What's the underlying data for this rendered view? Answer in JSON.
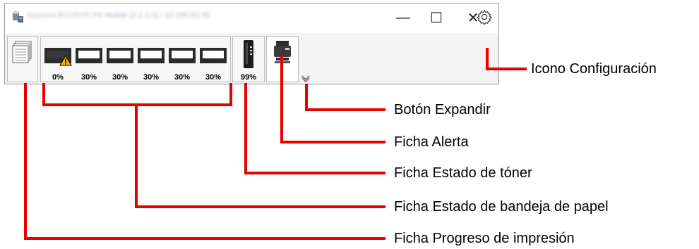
{
  "window": {
    "title": "Kyocera ECOSYS P4 Mobile (2.1.1.0) / 10.180.62.35",
    "minimize_label": "—",
    "maximize_label": "☐",
    "close_label": "✕"
  },
  "tabs": {
    "progress": {
      "icon": "printer-stack-icon"
    },
    "trays": [
      {
        "level": "0%",
        "warning": true
      },
      {
        "level": "30%",
        "warning": false
      },
      {
        "level": "30%",
        "warning": false
      },
      {
        "level": "30%",
        "warning": false
      },
      {
        "level": "30%",
        "warning": false
      },
      {
        "level": "30%",
        "warning": false
      }
    ],
    "toner": {
      "level": "99%"
    },
    "alert": {
      "icon": "printer-icon"
    }
  },
  "icons": {
    "settings": "gear-icon",
    "expand": "chevron-down-icon"
  },
  "callouts": {
    "settings": "Icono Configuración",
    "expand": "Botón Expandir",
    "alert": "Ficha Alerta",
    "toner": "Ficha Estado de tóner",
    "trays": "Ficha Estado de bandeja de papel",
    "progress": "Ficha Progreso de impresión"
  },
  "colors": {
    "callout_line": "#e80000",
    "warning": "#f2b705"
  }
}
